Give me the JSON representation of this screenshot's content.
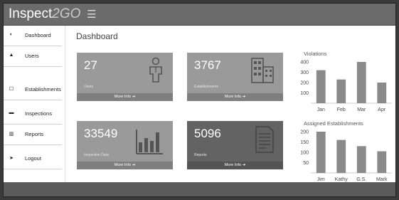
{
  "app": {
    "brand_main": "Inspect",
    "brand_accent": "2GO",
    "menu_icon": "☰"
  },
  "sidebar": {
    "items": [
      {
        "icon": "dashboard-icon",
        "glyph": "◐",
        "label": "Dashboard"
      },
      {
        "icon": "user-icon",
        "glyph": "▲",
        "label": "Users"
      },
      {
        "icon": "establishment-icon",
        "glyph": "☐",
        "label": "Establishments"
      },
      {
        "icon": "inspection-icon",
        "glyph": "▬",
        "label": "Inspections"
      },
      {
        "icon": "chart-icon",
        "glyph": "▥",
        "label": "Reports"
      },
      {
        "icon": "logout-icon",
        "glyph": "➤",
        "label": "Logout"
      }
    ]
  },
  "main": {
    "title": "Dashboard",
    "cards": [
      {
        "value": "27",
        "subtitle": "Users",
        "footer": "More Info ➜",
        "icon": "user-figure-icon"
      },
      {
        "value": "3767",
        "subtitle": "Establishments",
        "footer": "More Info ➜",
        "icon": "buildings-icon"
      },
      {
        "value": "33549",
        "subtitle": "Inspection Data",
        "footer": "More Info ➜",
        "icon": "bar-chart-icon"
      },
      {
        "value": "5096",
        "subtitle": "Reports",
        "footer": "More Info ➜",
        "icon": "document-icon"
      }
    ]
  },
  "chart_data": [
    {
      "type": "bar",
      "title": "Violations",
      "categories": [
        "Jan",
        "Feb",
        "Mar",
        "Apr"
      ],
      "values": [
        320,
        230,
        400,
        200
      ],
      "yticks": [
        "400",
        "300",
        "200",
        "100"
      ],
      "ylim": [
        0,
        400
      ],
      "color": "#8a8a8a"
    },
    {
      "type": "bar",
      "title": "Assigned Establishments",
      "categories": [
        "Jim",
        "Kathy",
        "G.S.",
        "Mark"
      ],
      "values": [
        200,
        160,
        130,
        105
      ],
      "yticks": [
        "200",
        "150",
        "100",
        "50"
      ],
      "ylim": [
        0,
        200
      ],
      "color": "#8a8a8a"
    }
  ]
}
